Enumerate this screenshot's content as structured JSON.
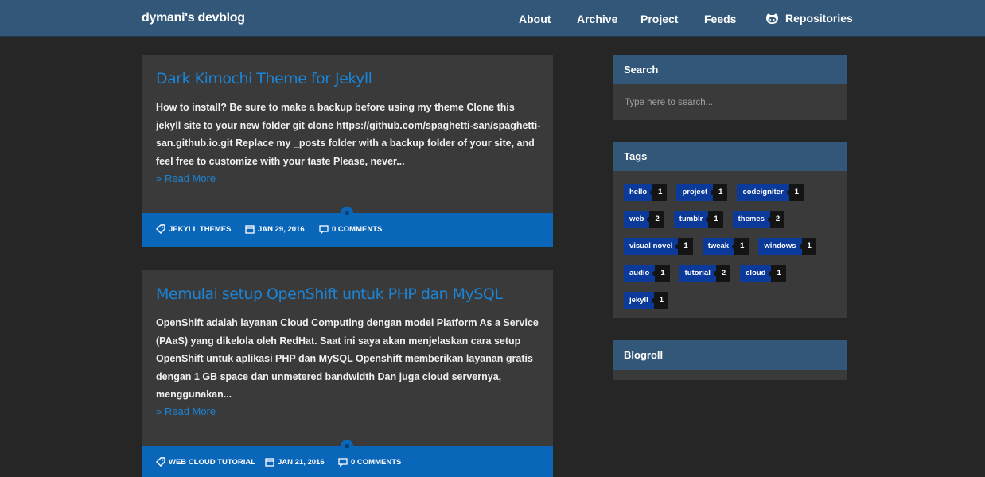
{
  "navbar": {
    "brand": "dymani's devblog",
    "links": [
      "About",
      "Archive",
      "Project",
      "Feeds"
    ],
    "repositories": "Repositories"
  },
  "posts": [
    {
      "title": "Dark Kimochi Theme for Jekyll",
      "excerpt": "How to install? Be sure to make a backup before using my theme Clone this jekyll site to your new folder git clone https://github.com/spaghetti-san/spaghetti-san.github.io.git Replace my _posts folder with a backup folder of your site, and feel free to customize with your taste Please, never...",
      "read_more": "» Read More",
      "category": "JEKYLL THEMES",
      "date": "JAN 29, 2016",
      "comments": "0 COMMENTS"
    },
    {
      "title": "Memulai setup OpenShift untuk PHP dan MySQL",
      "excerpt": "OpenShift adalah layanan Cloud Computing dengan model Platform As a Service (PAaS) yang dikelola oleh RedHat. Saat ini saya akan menjelaskan cara setup OpenShift untuk aplikasi PHP dan MySQL Openshift memberikan layanan gratis dengan 1 GB space dan unmetered bandwidth Dan juga cloud servernya, menggunakan...",
      "read_more": "» Read More",
      "category": "WEB CLOUD TUTORIAL",
      "date": "JAN 21, 2016",
      "comments": "0 COMMENTS"
    }
  ],
  "sidebar": {
    "search": {
      "title": "Search",
      "placeholder": "Type here to search..."
    },
    "tags": {
      "title": "Tags",
      "items": [
        {
          "name": "hello",
          "count": "1"
        },
        {
          "name": "project",
          "count": "1"
        },
        {
          "name": "codeigniter",
          "count": "1"
        },
        {
          "name": "web",
          "count": "2"
        },
        {
          "name": "tumblr",
          "count": "1"
        },
        {
          "name": "themes",
          "count": "2"
        },
        {
          "name": "visual novel",
          "count": "1"
        },
        {
          "name": "tweak",
          "count": "1"
        },
        {
          "name": "windows",
          "count": "1"
        },
        {
          "name": "audio",
          "count": "1"
        },
        {
          "name": "tutorial",
          "count": "2"
        },
        {
          "name": "cloud",
          "count": "1"
        },
        {
          "name": "jekyll",
          "count": "1"
        }
      ]
    },
    "blogroll": {
      "title": "Blogroll"
    }
  },
  "colors": {
    "navbar": "#325778",
    "background": "#262626",
    "card": "#3a3a3a",
    "link_blue": "#1b84d6",
    "footer_blue": "#0a66b8",
    "tag_blue": "#0b3a9a"
  },
  "icons": [
    "github-icon",
    "tag-icon",
    "calendar-icon",
    "comment-icon"
  ]
}
